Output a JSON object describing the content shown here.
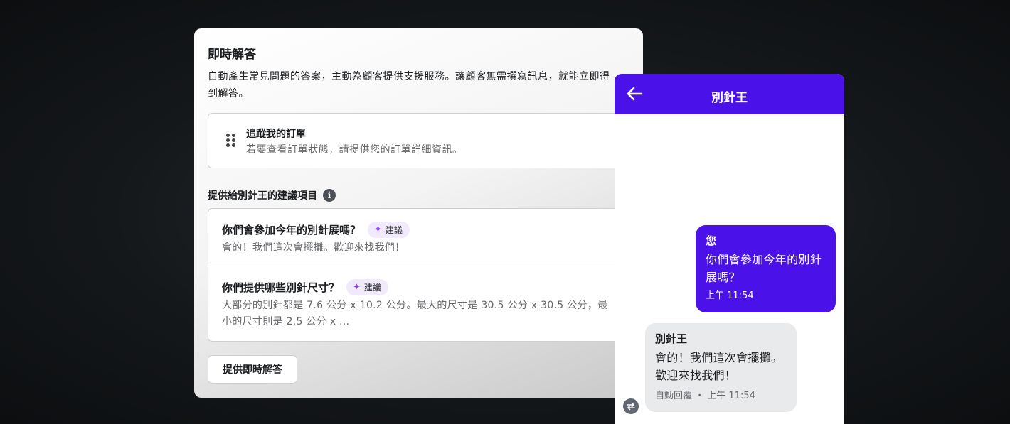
{
  "settings": {
    "title": "即時解答",
    "description": "自動產生常見問題的答案，主動為顧客提供支援服務。讓顧客無需撰寫訊息，就能立即得到解答。",
    "question": {
      "title": "追蹤我的訂單",
      "subtitle": "若要查看訂單狀態，請提供您的訂單詳細資訊。"
    },
    "suggestions_label": "提供給別針王的建議項目",
    "suggestions": [
      {
        "question": "你們會參加今年的別針展嗎？",
        "badge": "建議",
        "answer": "會的！我們這次會擺攤。歡迎來找我們！"
      },
      {
        "question": "你們提供哪些別針尺寸？",
        "badge": "建議",
        "answer": "大部分的別針都是 7.6 公分 x 10.2 公分。最大的尺寸是 30.5 公分 x 30.5 公分，最小的尺寸則是 2.5 公分 x ..."
      }
    ],
    "provide_button": "提供即時解答"
  },
  "chat": {
    "title": "別針王",
    "outgoing": {
      "sender": "您",
      "text": "你們會參加今年的別針展嗎？",
      "time": "上午 11:54"
    },
    "incoming": {
      "sender": "別針王",
      "text": "會的！我們這次會擺攤。歡迎來找我們！",
      "meta": "自動回覆 ・ 上午 11:54"
    }
  },
  "colors": {
    "brand_purple": "#4a12e8",
    "sparkle": "#8a3ffc",
    "badge_bg": "#f1eafc"
  },
  "icons": {
    "back": "arrow-left-icon",
    "drag": "drag-handle-icon",
    "info": "info-icon",
    "sparkle": "sparkle-icon",
    "auto_reply": "repeat-icon"
  }
}
